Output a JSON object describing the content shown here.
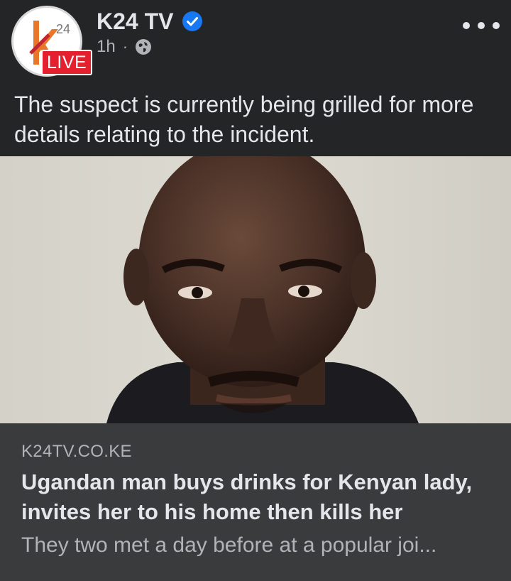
{
  "post": {
    "page_name": "K24 TV",
    "verified_icon": "verified-badge-icon",
    "timestamp": "1h",
    "separator": "·",
    "audience_icon": "globe-icon",
    "live_label": "LIVE",
    "avatar_logo_text": "24",
    "more_icon": "more-options-icon",
    "caption": "The suspect is currently being grilled for more details relating to the incident."
  },
  "link_preview": {
    "domain": "K24TV.CO.KE",
    "title": "Ugandan man buys drinks for Kenyan lady, invites her to his home then kills her",
    "description": "They two met a day before at a popular joi..."
  },
  "colors": {
    "background": "#242526",
    "card": "#3a3b3c",
    "verified_blue": "#1877f2",
    "live_red": "#e4202f",
    "secondary_text": "#b0b3b8"
  }
}
